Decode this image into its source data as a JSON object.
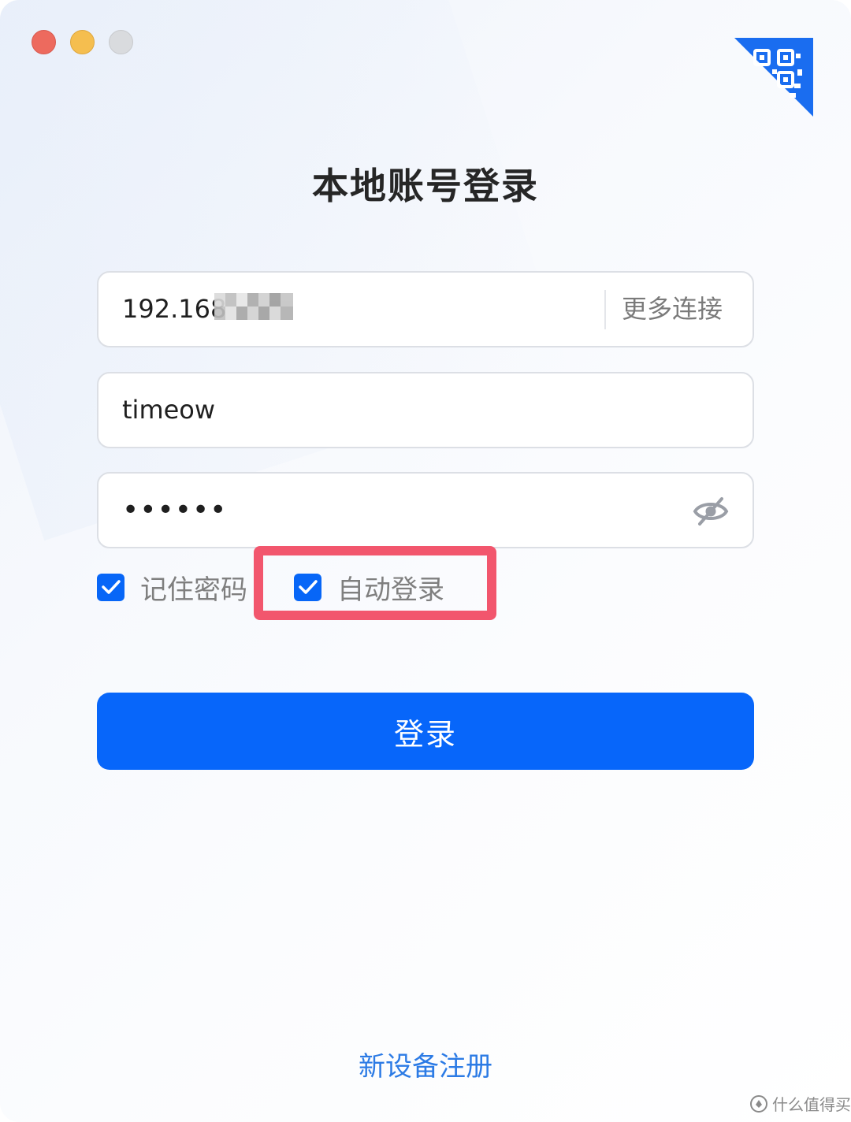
{
  "header": {
    "title": "本地账号登录"
  },
  "form": {
    "address_value": "192.168",
    "more_connections_label": "更多连接",
    "username_value": "timeow",
    "password_mask": "••••••",
    "remember_password_label": "记住密码",
    "remember_password_checked": true,
    "auto_login_label": "自动登录",
    "auto_login_checked": true,
    "login_button_label": "登录"
  },
  "footer": {
    "register_link": "新设备注册"
  },
  "watermark": {
    "text": "什么值得买"
  },
  "icons": {
    "qr_corner": "qr-code-icon",
    "password_visibility": "eye-off-icon",
    "checkbox": "checkmark-icon"
  },
  "colors": {
    "accent": "#0766fa",
    "highlight": "#f2566d",
    "link": "#2c7be5",
    "traffic_close": "#ed6a5e",
    "traffic_minimize": "#f5be4f",
    "traffic_maximize": "#d9dbde"
  }
}
